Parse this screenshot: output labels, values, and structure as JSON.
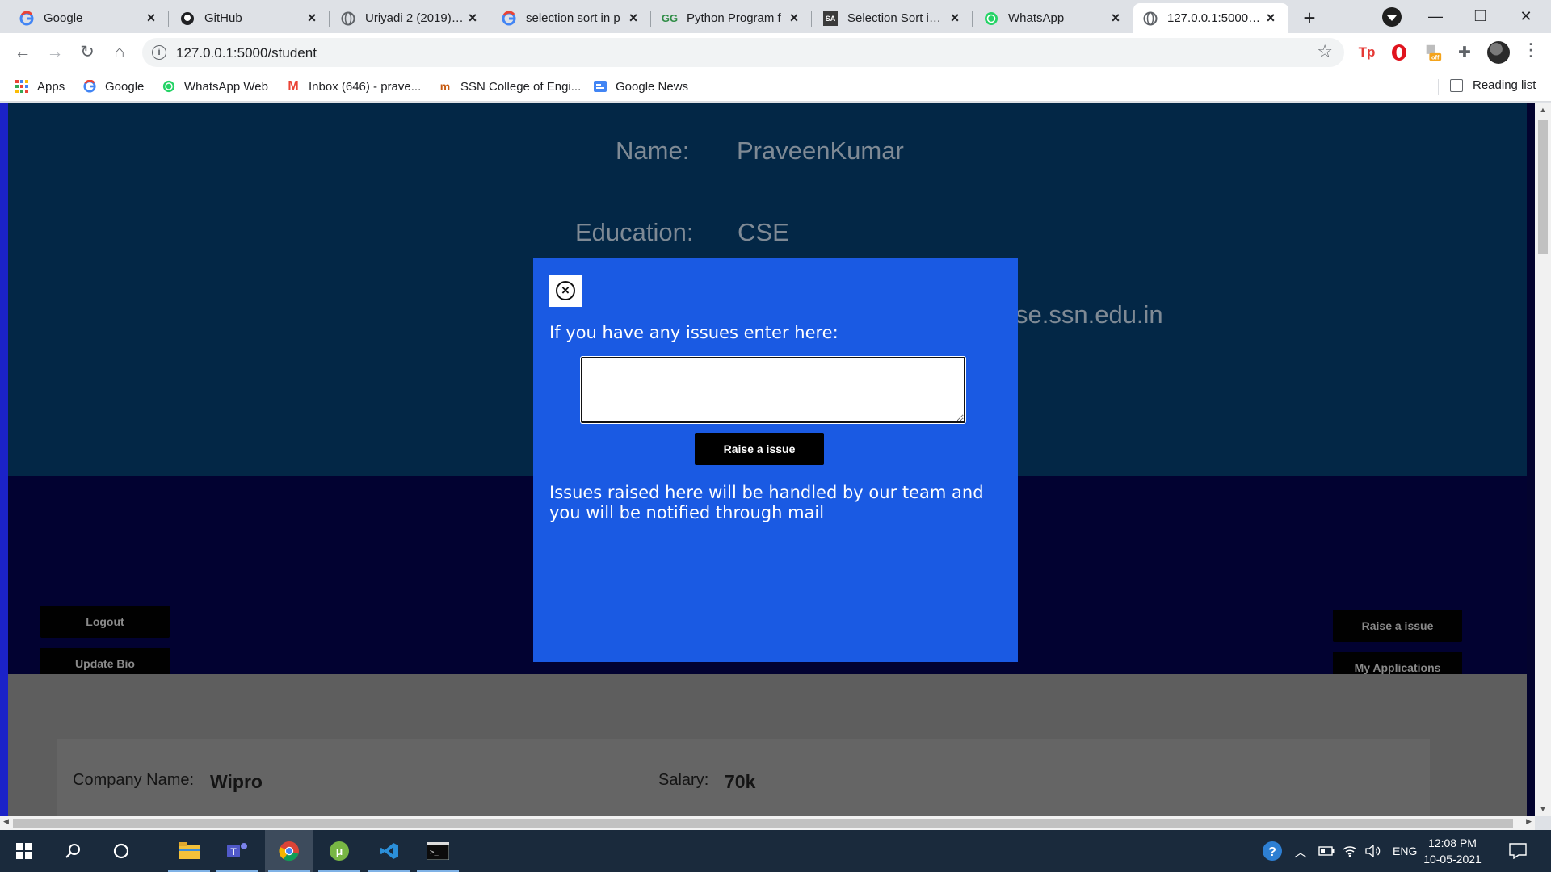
{
  "browser": {
    "tabs": [
      {
        "title": "Google",
        "favicon": "google-icon"
      },
      {
        "title": "GitHub",
        "favicon": "github-icon"
      },
      {
        "title": "Uriyadi 2 (2019) Ta",
        "favicon": "globe-icon"
      },
      {
        "title": "selection sort in p",
        "favicon": "google-icon"
      },
      {
        "title": "Python Program f",
        "favicon": "gfg-icon"
      },
      {
        "title": "Selection Sort in P",
        "favicon": "sa-icon"
      },
      {
        "title": "WhatsApp",
        "favicon": "whatsapp-icon"
      },
      {
        "title": "127.0.0.1:5000/stu",
        "favicon": "globe-icon",
        "active": true
      }
    ],
    "url": "127.0.0.1:5000/student",
    "bookmarks": [
      {
        "label": "Apps",
        "icon": "apps-grid-icon"
      },
      {
        "label": "Google",
        "icon": "google-icon"
      },
      {
        "label": "WhatsApp Web",
        "icon": "whatsapp-icon"
      },
      {
        "label": "Inbox (646) - prave...",
        "icon": "gmail-icon"
      },
      {
        "label": "SSN College of Engi...",
        "icon": "ssn-icon"
      },
      {
        "label": "Google News",
        "icon": "google-news-icon"
      }
    ],
    "reading_list": "Reading list"
  },
  "page": {
    "name_label": "Name:",
    "name_value": "PraveenKumar",
    "education_label": "Education:",
    "education_value": "CSE",
    "email_partial": "se.ssn.edu.in",
    "buttons": {
      "logout": "Logout",
      "update_bio": "Update Bio",
      "raise_issue": "Raise a issue",
      "my_applications": "My Applications"
    },
    "job": {
      "company_label": "Company Name:",
      "company_value": "Wipro",
      "salary_label": "Salary:",
      "salary_value": "70k"
    }
  },
  "modal": {
    "prompt": "If you have any issues enter here:",
    "textarea_value": "",
    "submit_label": "Raise a issue",
    "note": "Issues raised here will be handled by our team and you will be notified through mail"
  },
  "taskbar": {
    "language": "ENG",
    "time": "12:08 PM",
    "date": "10-05-2021"
  },
  "colors": {
    "modal_bg": "#1a5ae3",
    "profile_band": "#032746",
    "action_band": "#020231",
    "jobs_band": "#5e5e5e"
  }
}
